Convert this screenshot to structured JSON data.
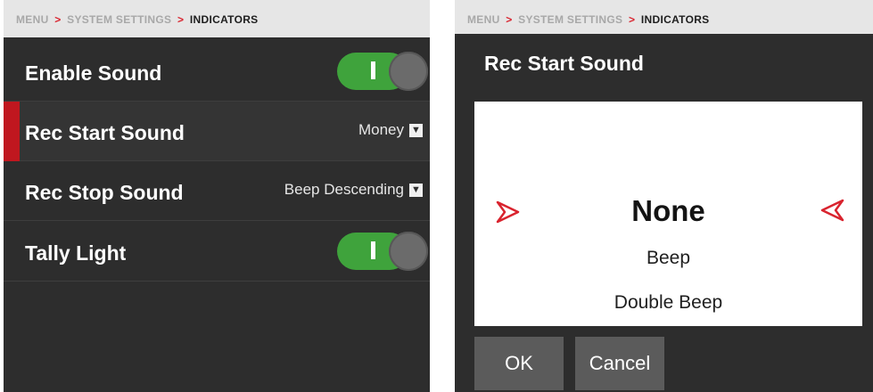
{
  "left_panel": {
    "breadcrumb": {
      "menu": "MENU",
      "sep1": ">",
      "system": "SYSTEM SETTINGS",
      "sep2": ">",
      "active": "INDICATORS"
    },
    "rows": [
      {
        "label": "Enable Sound",
        "control": "toggle",
        "on": true
      },
      {
        "label": "Rec Start Sound",
        "control": "dropdown",
        "value": "Money",
        "selected": true
      },
      {
        "label": "Rec Stop Sound",
        "control": "dropdown",
        "value": "Beep Descending"
      },
      {
        "label": "Tally Light",
        "control": "toggle",
        "on": true
      }
    ],
    "dropdown_arrow": "▼"
  },
  "right_panel": {
    "breadcrumb": {
      "menu": "MENU",
      "sep1": ">",
      "system": "SYSTEM SETTINGS",
      "sep2": ">",
      "active": "INDICATORS"
    },
    "title": "Rec Start Sound",
    "picker": {
      "selected": "None",
      "options": [
        "Beep",
        "Double Beep"
      ]
    },
    "buttons": {
      "ok": "OK",
      "cancel": "Cancel"
    }
  },
  "colors": {
    "accent_red": "#d9232e",
    "toggle_on": "#3fa33c",
    "background": "#2d2d2d"
  },
  "icons": [
    "toggle-switch-icon",
    "dropdown-arrow-icon",
    "left-triangle-arrow-icon",
    "right-triangle-arrow-icon"
  ]
}
